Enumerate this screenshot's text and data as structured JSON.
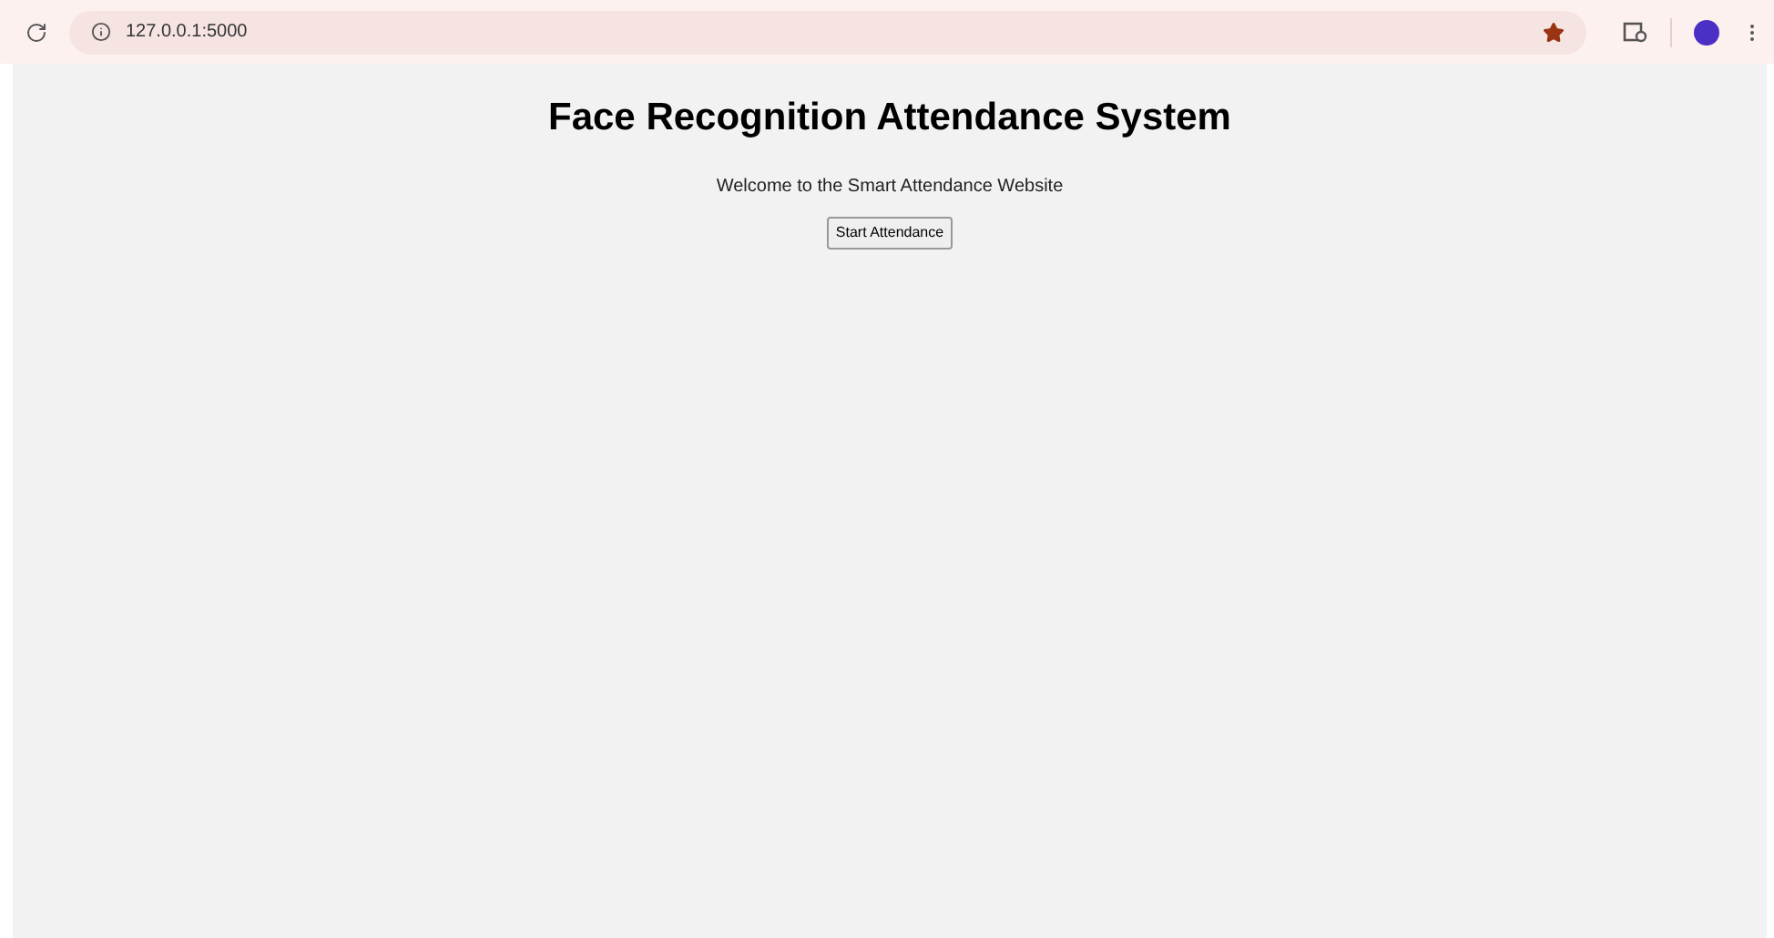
{
  "browser": {
    "url": "127.0.0.1:5000",
    "bookmarked": true
  },
  "page": {
    "heading": "Face Recognition Attendance System",
    "welcome": "Welcome to the Smart Attendance Website",
    "button": "Start Attendance"
  }
}
